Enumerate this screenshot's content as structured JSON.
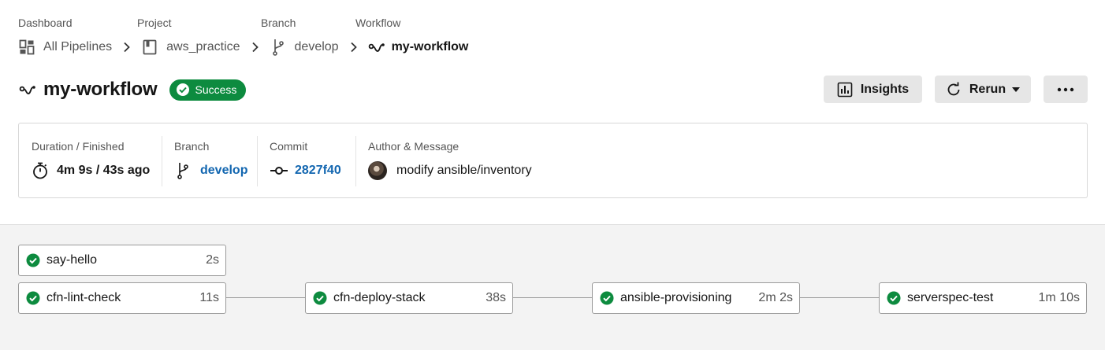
{
  "breadcrumb": {
    "dashboard": {
      "heading": "Dashboard",
      "label": "All Pipelines",
      "icon": "dashboard-icon"
    },
    "project": {
      "heading": "Project",
      "label": "aws_practice",
      "icon": "project-icon"
    },
    "branch": {
      "heading": "Branch",
      "label": "develop",
      "icon": "branch-icon"
    },
    "workflow": {
      "heading": "Workflow",
      "label": "my-workflow",
      "icon": "workflow-icon"
    }
  },
  "header": {
    "title": "my-workflow",
    "status": "Success",
    "status_color": "#0d8b3f",
    "insights_label": "Insights",
    "rerun_label": "Rerun"
  },
  "info": {
    "duration": {
      "label": "Duration / Finished",
      "value": "4m 9s / 43s ago"
    },
    "branch": {
      "label": "Branch",
      "value": "develop"
    },
    "commit": {
      "label": "Commit",
      "value": "2827f40"
    },
    "author": {
      "label": "Author & Message",
      "message": "modify ansible/inventory"
    }
  },
  "jobs": [
    {
      "name": "say-hello",
      "duration": "2s",
      "status": "success"
    },
    {
      "name": "cfn-lint-check",
      "duration": "11s",
      "status": "success"
    },
    {
      "name": "cfn-deploy-stack",
      "duration": "38s",
      "status": "success"
    },
    {
      "name": "ansible-provisioning",
      "duration": "2m 2s",
      "status": "success"
    },
    {
      "name": "serverspec-test",
      "duration": "1m 10s",
      "status": "success"
    }
  ],
  "colors": {
    "link": "#1266b0",
    "success": "#0d8b3f"
  }
}
